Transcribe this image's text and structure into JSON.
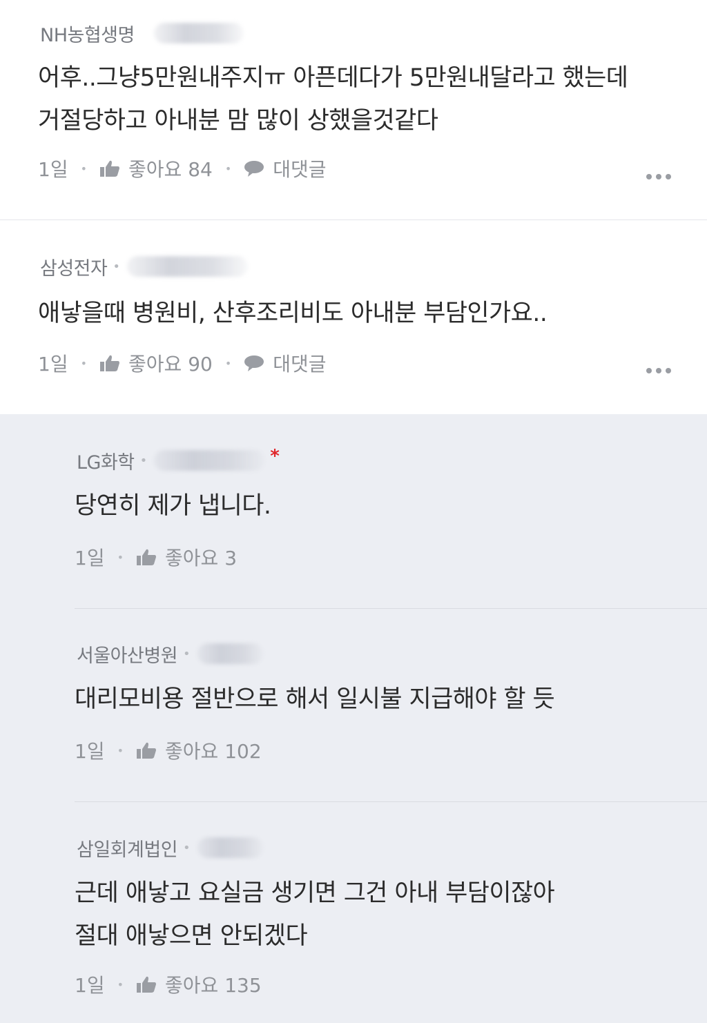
{
  "comments": [
    {
      "company": "NH농협생명",
      "text": "어후..그냥5만원내주지ㅠ 아픈데다가 5만원내달라고 했는데\n거절당하고 아내분 맘 많이 상했을것같다",
      "time": "1일",
      "like_label": "좋아요 84",
      "reply_label": "대댓글"
    },
    {
      "company": "삼성전자",
      "text": "애낳을때 병원비, 산후조리비도 아내분 부담인가요..",
      "time": "1일",
      "like_label": "좋아요 90",
      "reply_label": "대댓글"
    }
  ],
  "replies": [
    {
      "company": "LG화학",
      "star": "*",
      "text": "당연히 제가 냅니다.",
      "time": "1일",
      "like_label": "좋아요 3"
    },
    {
      "company": "서울아산병원",
      "text": "대리모비용 절반으로 해서 일시불 지급해야 할 듯",
      "time": "1일",
      "like_label": "좋아요 102"
    },
    {
      "company": "삼일회계법인",
      "text": "근데 애낳고 요실금 생기면 그건 아내 부담이잖아\n절대 애낳으면 안되겠다",
      "time": "1일",
      "like_label": "좋아요 135"
    }
  ],
  "colors": {
    "reply_background": "#eceef3",
    "best_star": "#e0262b",
    "meta_text": "#8f9297"
  },
  "icons": [
    "thumbs-up-icon",
    "speech-bubble-icon",
    "more-options-icon"
  ]
}
